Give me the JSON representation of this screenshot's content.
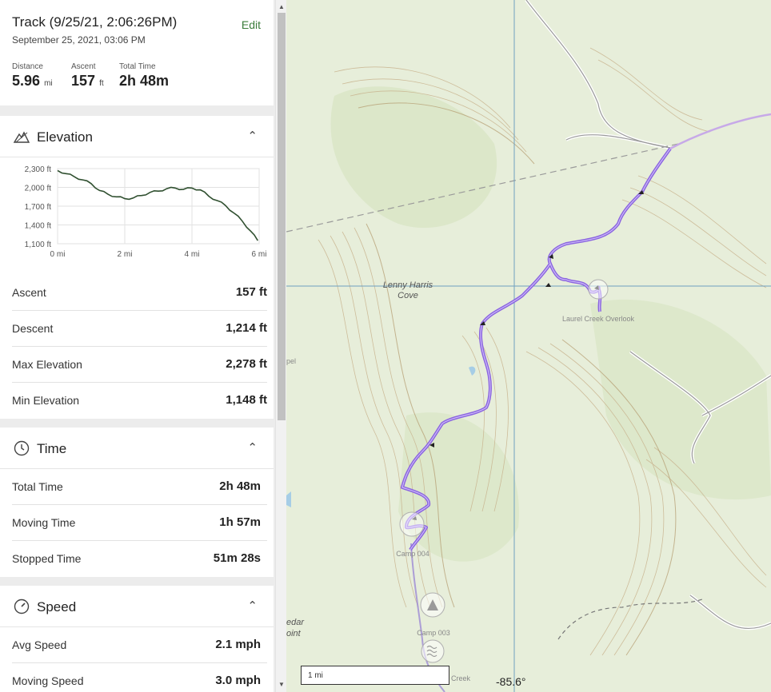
{
  "track": {
    "title": "Track (9/25/21, 2:06:26PM)",
    "date": "September 25, 2021, 03:06 PM",
    "edit_label": "Edit"
  },
  "summary": {
    "distance_label": "Distance",
    "distance_value": "5.96",
    "distance_unit": "mi",
    "ascent_label": "Ascent",
    "ascent_value": "157",
    "ascent_unit": "ft",
    "time_label": "Total Time",
    "time_value": "2h 48m"
  },
  "elevation": {
    "title": "Elevation",
    "rows": [
      {
        "label": "Ascent",
        "value": "157 ft"
      },
      {
        "label": "Descent",
        "value": "1,214 ft"
      },
      {
        "label": "Max Elevation",
        "value": "2,278 ft"
      },
      {
        "label": "Min Elevation",
        "value": "1,148 ft"
      }
    ]
  },
  "time": {
    "title": "Time",
    "rows": [
      {
        "label": "Total Time",
        "value": "2h 48m"
      },
      {
        "label": "Moving Time",
        "value": "1h 57m"
      },
      {
        "label": "Stopped Time",
        "value": "51m 28s"
      }
    ]
  },
  "speed": {
    "title": "Speed",
    "rows": [
      {
        "label": "Avg Speed",
        "value": "2.1 mph"
      },
      {
        "label": "Moving Speed",
        "value": "3.0 mph"
      }
    ]
  },
  "icons": {
    "elevation": "mountain-icon",
    "time": "clock-icon",
    "speed": "gauge-icon",
    "collapse": "chevron-up-icon"
  },
  "colors": {
    "track_line": "#8a63e0",
    "accent_green": "#3b7d3b",
    "elevation_line": "#2f4f2f"
  },
  "chart_data": {
    "type": "line",
    "title": "",
    "xlabel": "",
    "ylabel": "",
    "x_ticks": [
      "0 mi",
      "2 mi",
      "4 mi",
      "6 mi"
    ],
    "y_ticks": [
      "2,300 ft",
      "2,000 ft",
      "1,700 ft",
      "1,400 ft",
      "1,100 ft"
    ],
    "xlim": [
      0,
      6
    ],
    "ylim": [
      1100,
      2300
    ],
    "grid": true,
    "series": [
      {
        "x": [
          0,
          0.25,
          0.5,
          0.75,
          1.0,
          1.25,
          1.5,
          1.75,
          2.0,
          2.25,
          2.5,
          2.75,
          3.0,
          3.25,
          3.5,
          3.75,
          4.0,
          4.25,
          4.5,
          4.75,
          5.0,
          5.25,
          5.5,
          5.75,
          5.96
        ],
        "y": [
          2270,
          2220,
          2170,
          2120,
          2060,
          1950,
          1890,
          1850,
          1820,
          1830,
          1870,
          1920,
          1940,
          1980,
          1990,
          1970,
          1990,
          1960,
          1860,
          1790,
          1710,
          1590,
          1460,
          1300,
          1150
        ]
      }
    ]
  },
  "map": {
    "place_label_1": "Lenny Harris",
    "place_label_2": "Cove",
    "overlook_label": "Laurel Creek Overlook",
    "cedar_label_1": "edar",
    "cedar_label_2": "oint",
    "camp_label_1": "Camp 004",
    "camp_label_2": "Camp 003",
    "pel_label": "pel",
    "creek_label": "Creek",
    "scale_label": "1 mi",
    "longitude": "-85.6°"
  }
}
